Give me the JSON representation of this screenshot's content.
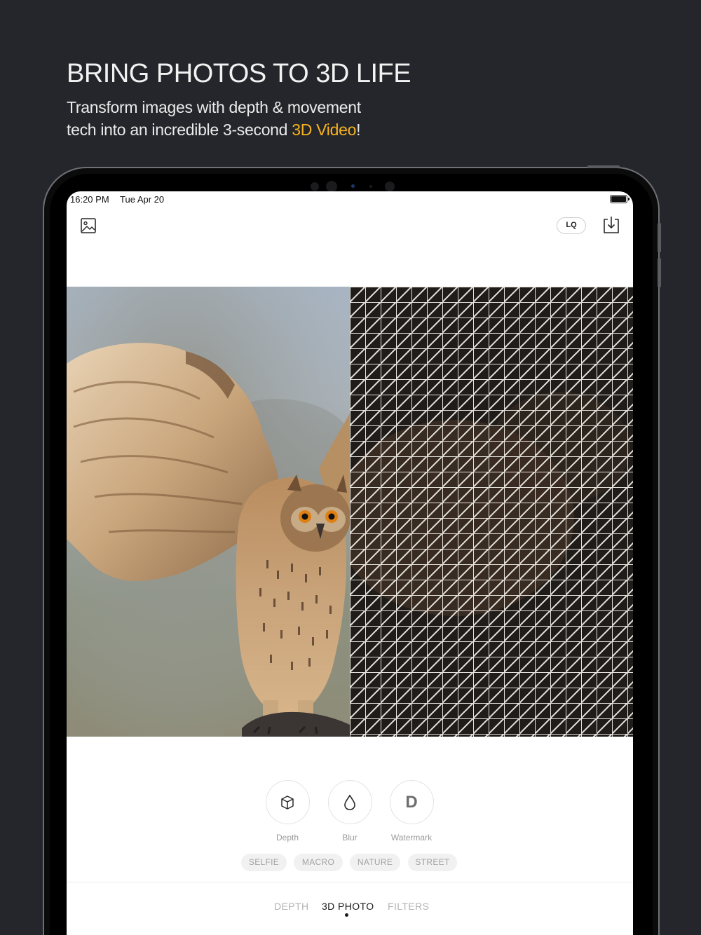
{
  "promo": {
    "headline": "BRING PHOTOS TO 3D LIFE",
    "sub_line1": "Transform images with depth & movement",
    "sub_line2_prefix": "tech into an incredible 3-second ",
    "sub_line2_accent": "3D Video",
    "sub_line2_suffix": "!",
    "accent_color": "#f5b21f"
  },
  "status_bar": {
    "time": "16:20 PM",
    "date": "Tue Apr 20",
    "battery_icon": "battery-full-icon"
  },
  "toolbar": {
    "gallery_icon": "image-gallery-icon",
    "quality_label": "LQ",
    "download_icon": "download-icon"
  },
  "viewer": {
    "left_panel": "owl-photo",
    "right_panel": "depth-mesh-overlay"
  },
  "tools": [
    {
      "label": "Depth",
      "icon": "cube-icon"
    },
    {
      "label": "Blur",
      "icon": "drop-icon"
    },
    {
      "label": "Watermark",
      "icon": "letter-d-icon",
      "glyph": "D"
    }
  ],
  "presets": [
    "SELFIE",
    "MACRO",
    "NATURE",
    "STREET"
  ],
  "tabs": [
    {
      "label": "DEPTH",
      "active": false
    },
    {
      "label": "3D PHOTO",
      "active": true
    },
    {
      "label": "FILTERS",
      "active": false
    }
  ]
}
